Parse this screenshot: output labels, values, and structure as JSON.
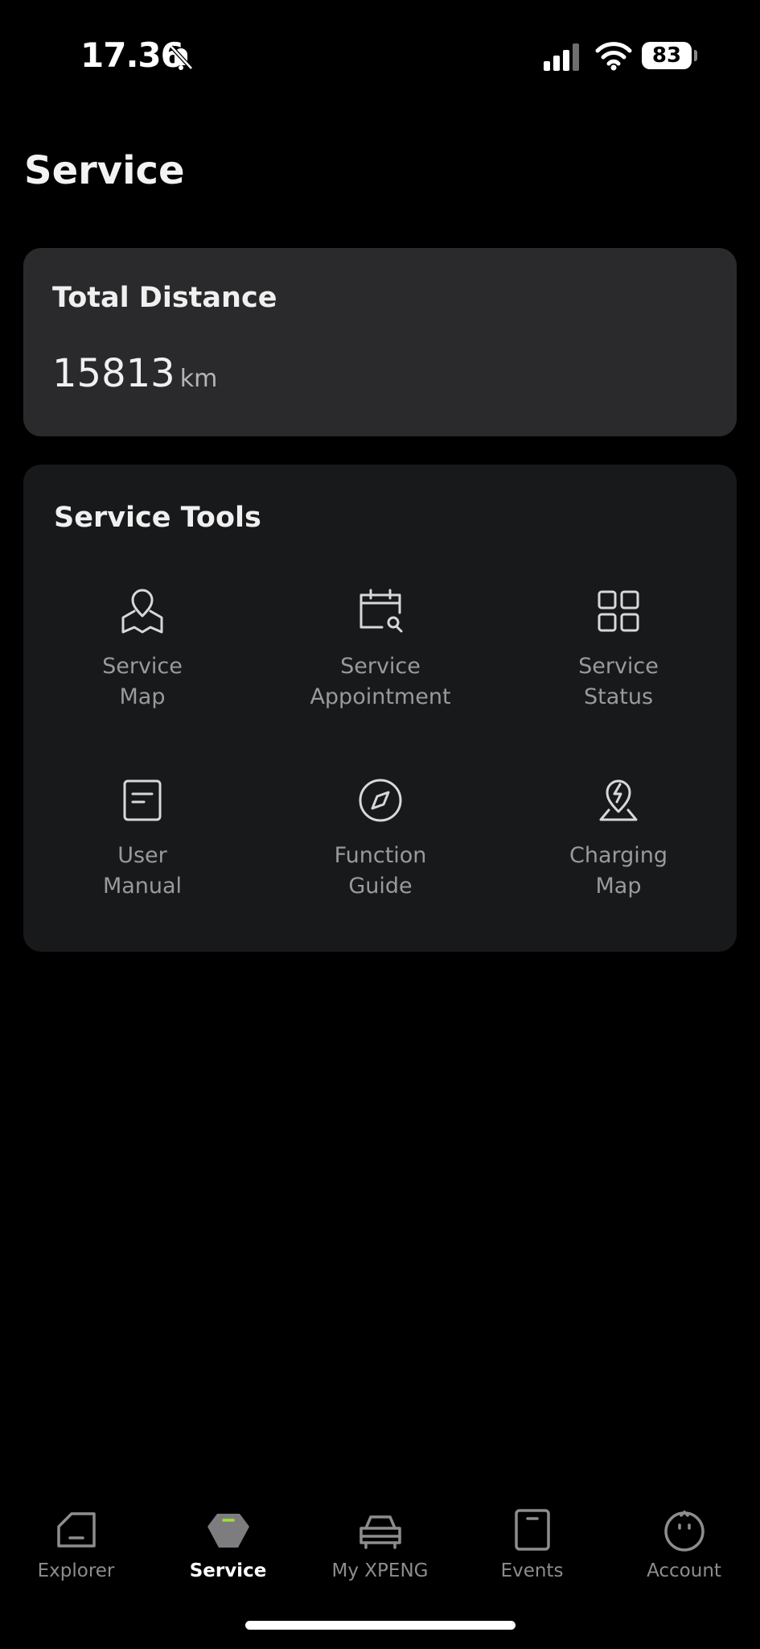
{
  "status_bar": {
    "time": "17.36",
    "battery": "83",
    "icons": [
      "bell-slash-icon",
      "signal-icon",
      "wifi-icon",
      "battery-icon"
    ]
  },
  "page": {
    "title": "Service"
  },
  "distance_card": {
    "label": "Total Distance",
    "value": "15813",
    "unit": "km"
  },
  "service_tools": {
    "title": "Service Tools",
    "items": [
      {
        "line1": "Service",
        "line2": "Map",
        "icon": "map-pin-icon"
      },
      {
        "line1": "Service",
        "line2": "Appointment",
        "icon": "calendar-search-icon"
      },
      {
        "line1": "Service",
        "line2": "Status",
        "icon": "grid-icon"
      },
      {
        "line1": "User",
        "line2": "Manual",
        "icon": "document-icon"
      },
      {
        "line1": "Function",
        "line2": "Guide",
        "icon": "compass-icon"
      },
      {
        "line1": "Charging",
        "line2": "Map",
        "icon": "charging-pin-icon"
      }
    ]
  },
  "bottom_nav": {
    "items": [
      {
        "label": "Explorer",
        "icon": "home-icon",
        "active": false
      },
      {
        "label": "Service",
        "icon": "service-icon",
        "active": true
      },
      {
        "label": "My XPENG",
        "icon": "car-icon",
        "active": false
      },
      {
        "label": "Events",
        "icon": "events-icon",
        "active": false
      },
      {
        "label": "Account",
        "icon": "account-icon",
        "active": false
      }
    ]
  },
  "colors": {
    "background": "#000000",
    "card_dark": "#2a2a2c",
    "card_tools": "#18191b",
    "accent": "#9be03a",
    "muted_text": "#9a9a9c"
  }
}
